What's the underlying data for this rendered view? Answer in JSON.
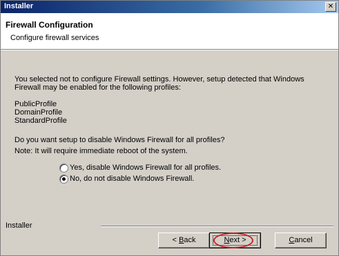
{
  "window": {
    "title": "Installer",
    "close_glyph": "✕"
  },
  "header": {
    "title": "Firewall Configuration",
    "subtitle": "Configure firewall services"
  },
  "content": {
    "message": "You selected not to configure Firewall settings. However, setup detected that Windows Firewall may be enabled for the following profiles:",
    "profiles": [
      "PublicProfile",
      "DomainProfile",
      "StandardProfile"
    ],
    "question": "Do you want setup to disable Windows Firewall for all profiles?",
    "note": "Note: It will require immediate reboot of the system.",
    "options": [
      {
        "label": "Yes, disable Windows Firewall for all profiles.",
        "selected": false
      },
      {
        "label": "No, do not disable Windows Firewall.",
        "selected": true
      }
    ]
  },
  "footer": {
    "label": "Installer"
  },
  "buttons": {
    "back": {
      "accel": "B",
      "rest": "ack",
      "prefix": "< "
    },
    "next": {
      "accel": "N",
      "rest": "ext >"
    },
    "cancel": {
      "accel": "C",
      "rest": "ancel"
    }
  }
}
